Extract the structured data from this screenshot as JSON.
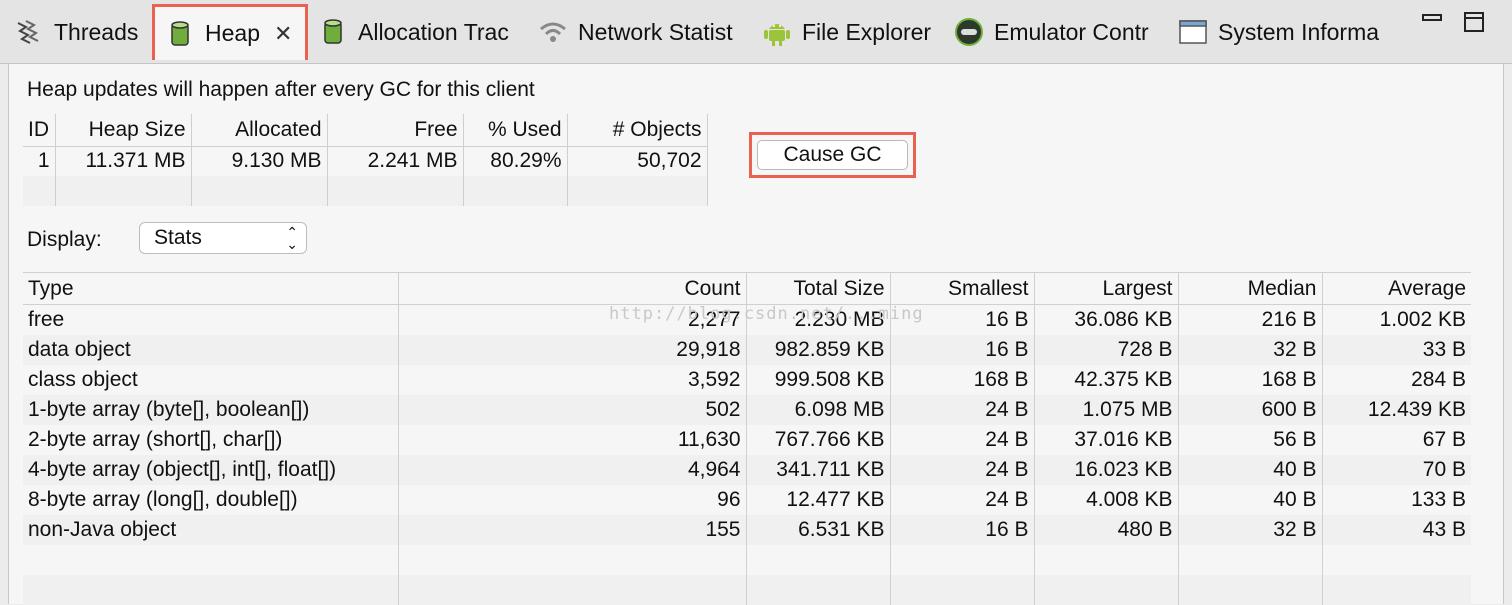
{
  "tabs": [
    {
      "label": "Threads",
      "icon": "threads-icon"
    },
    {
      "label": "Heap",
      "icon": "heap-cylinder-icon",
      "active": true
    },
    {
      "label": "Allocation Trac",
      "icon": "allocation-cylinder-icon"
    },
    {
      "label": "Network Statist",
      "icon": "wifi-icon"
    },
    {
      "label": "File Explorer",
      "icon": "android-icon"
    },
    {
      "label": "Emulator Contr",
      "icon": "emulator-icon"
    },
    {
      "label": "System Informa",
      "icon": "window-icon"
    }
  ],
  "heap": {
    "notice": "Heap updates will happen after every GC for this client",
    "columns": [
      "ID",
      "Heap Size",
      "Allocated",
      "Free",
      "% Used",
      "# Objects"
    ],
    "rows": [
      [
        "1",
        "11.371 MB",
        "9.130 MB",
        "2.241 MB",
        "80.29%",
        "50,702"
      ]
    ],
    "cause_gc_label": "Cause GC"
  },
  "display": {
    "label": "Display:",
    "selected": "Stats"
  },
  "stats": {
    "columns": [
      "Type",
      "Count",
      "Total Size",
      "Smallest",
      "Largest",
      "Median",
      "Average"
    ],
    "rows": [
      [
        "free",
        "2,277",
        "2.230 MB",
        "16 B",
        "36.086 KB",
        "216 B",
        "1.002 KB"
      ],
      [
        "data object",
        "29,918",
        "982.859 KB",
        "16 B",
        "728 B",
        "32 B",
        "33 B"
      ],
      [
        "class object",
        "3,592",
        "999.508 KB",
        "168 B",
        "42.375 KB",
        "168 B",
        "284 B"
      ],
      [
        "1-byte array (byte[], boolean[])",
        "502",
        "6.098 MB",
        "24 B",
        "1.075 MB",
        "600 B",
        "12.439 KB"
      ],
      [
        "2-byte array (short[], char[])",
        "11,630",
        "767.766 KB",
        "24 B",
        "37.016 KB",
        "56 B",
        "67 B"
      ],
      [
        "4-byte array (object[], int[], float[])",
        "4,964",
        "341.711 KB",
        "24 B",
        "16.023 KB",
        "40 B",
        "70 B"
      ],
      [
        "8-byte array (long[], double[])",
        "96",
        "12.477 KB",
        "24 B",
        "4.008 KB",
        "40 B",
        "133 B"
      ],
      [
        "non-Java object",
        "155",
        "6.531 KB",
        "16 B",
        "480 B",
        "32 B",
        "43 B"
      ]
    ]
  },
  "watermark": "http://blog.csdn.net/...ming",
  "colors": {
    "highlight": "#e8624f",
    "android_green": "#9bc43a"
  }
}
